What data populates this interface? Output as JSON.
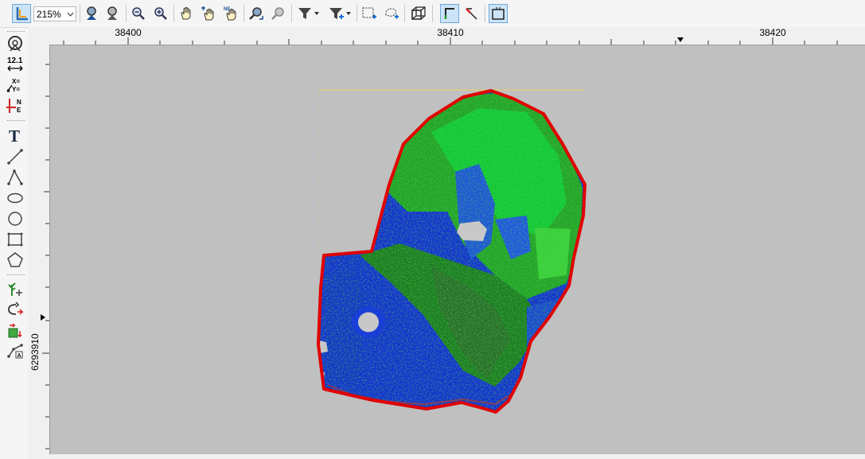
{
  "toolbar": {
    "zoom_value": "215%",
    "buttons": [
      {
        "name": "coordinate-system-button",
        "icon": "axes-icon",
        "active": true
      },
      {
        "name": "zoom-in-button",
        "icon": "zoom-in-icon"
      },
      {
        "name": "zoom-out-button",
        "icon": "zoom-out-icon"
      },
      {
        "name": "zoom-previous-button",
        "icon": "magnifier-minus-icon"
      },
      {
        "name": "zoom-next-button",
        "icon": "magnifier-plus-icon"
      },
      {
        "name": "pan-button",
        "icon": "hand-icon"
      },
      {
        "name": "pan-fit-button",
        "icon": "hand-grid-icon"
      },
      {
        "name": "pan-north-button",
        "icon": "hand-north-icon"
      },
      {
        "name": "zoom-extent-button",
        "icon": "zoom-extent-icon"
      },
      {
        "name": "zoom-selection-button",
        "icon": "zoom-selection-icon"
      },
      {
        "name": "filter-button",
        "icon": "funnel-icon"
      },
      {
        "name": "filter-add-button",
        "icon": "funnel-plus-icon"
      },
      {
        "name": "select-rectangle-button",
        "icon": "rectangle-select-icon"
      },
      {
        "name": "select-lasso-button",
        "icon": "lasso-select-icon"
      },
      {
        "name": "3d-view-button",
        "icon": "cube-icon"
      },
      {
        "name": "corner-snap-button",
        "icon": "corner-icon",
        "active": true
      },
      {
        "name": "pointer-snap-button",
        "icon": "pointer-icon"
      },
      {
        "name": "frame-button",
        "icon": "frame-icon",
        "active": true
      }
    ]
  },
  "left_tools": [
    {
      "name": "locate-tool",
      "icon": "locate-icon"
    },
    {
      "name": "measure-distance-tool",
      "icon": "measure-icon",
      "label": "12.1"
    },
    {
      "name": "xy-coordinates-tool",
      "icon": "xy-icon",
      "label": "X= Y="
    },
    {
      "name": "north-east-tool",
      "icon": "ne-icon",
      "label": "N E"
    },
    {
      "name": "text-tool",
      "icon": "text-icon",
      "label": "T"
    },
    {
      "name": "line-tool",
      "icon": "line-icon"
    },
    {
      "name": "polyline-tool",
      "icon": "polyline-icon"
    },
    {
      "name": "ellipse-tool",
      "icon": "ellipse-icon"
    },
    {
      "name": "circle-tool",
      "icon": "circle-icon"
    },
    {
      "name": "rectangle-tool",
      "icon": "rectangle-icon"
    },
    {
      "name": "polygon-tool",
      "icon": "polygon-icon"
    },
    {
      "name": "add-point-tool",
      "icon": "tree-plus-icon"
    },
    {
      "name": "rotate-tool",
      "icon": "rotate-icon"
    },
    {
      "name": "layer-move-tool",
      "icon": "layer-move-icon"
    },
    {
      "name": "node-edit-tool",
      "icon": "node-edit-icon"
    }
  ],
  "ruler": {
    "x_labels": [
      "38400",
      "38410",
      "38420"
    ],
    "y_label": "6293910"
  },
  "colors": {
    "canvas": "#c0c0c0",
    "boundary": "#e00000",
    "surface_blue": "#1a3fd6",
    "surface_green": "#2ea82e",
    "active_button": "#cce4f7"
  }
}
